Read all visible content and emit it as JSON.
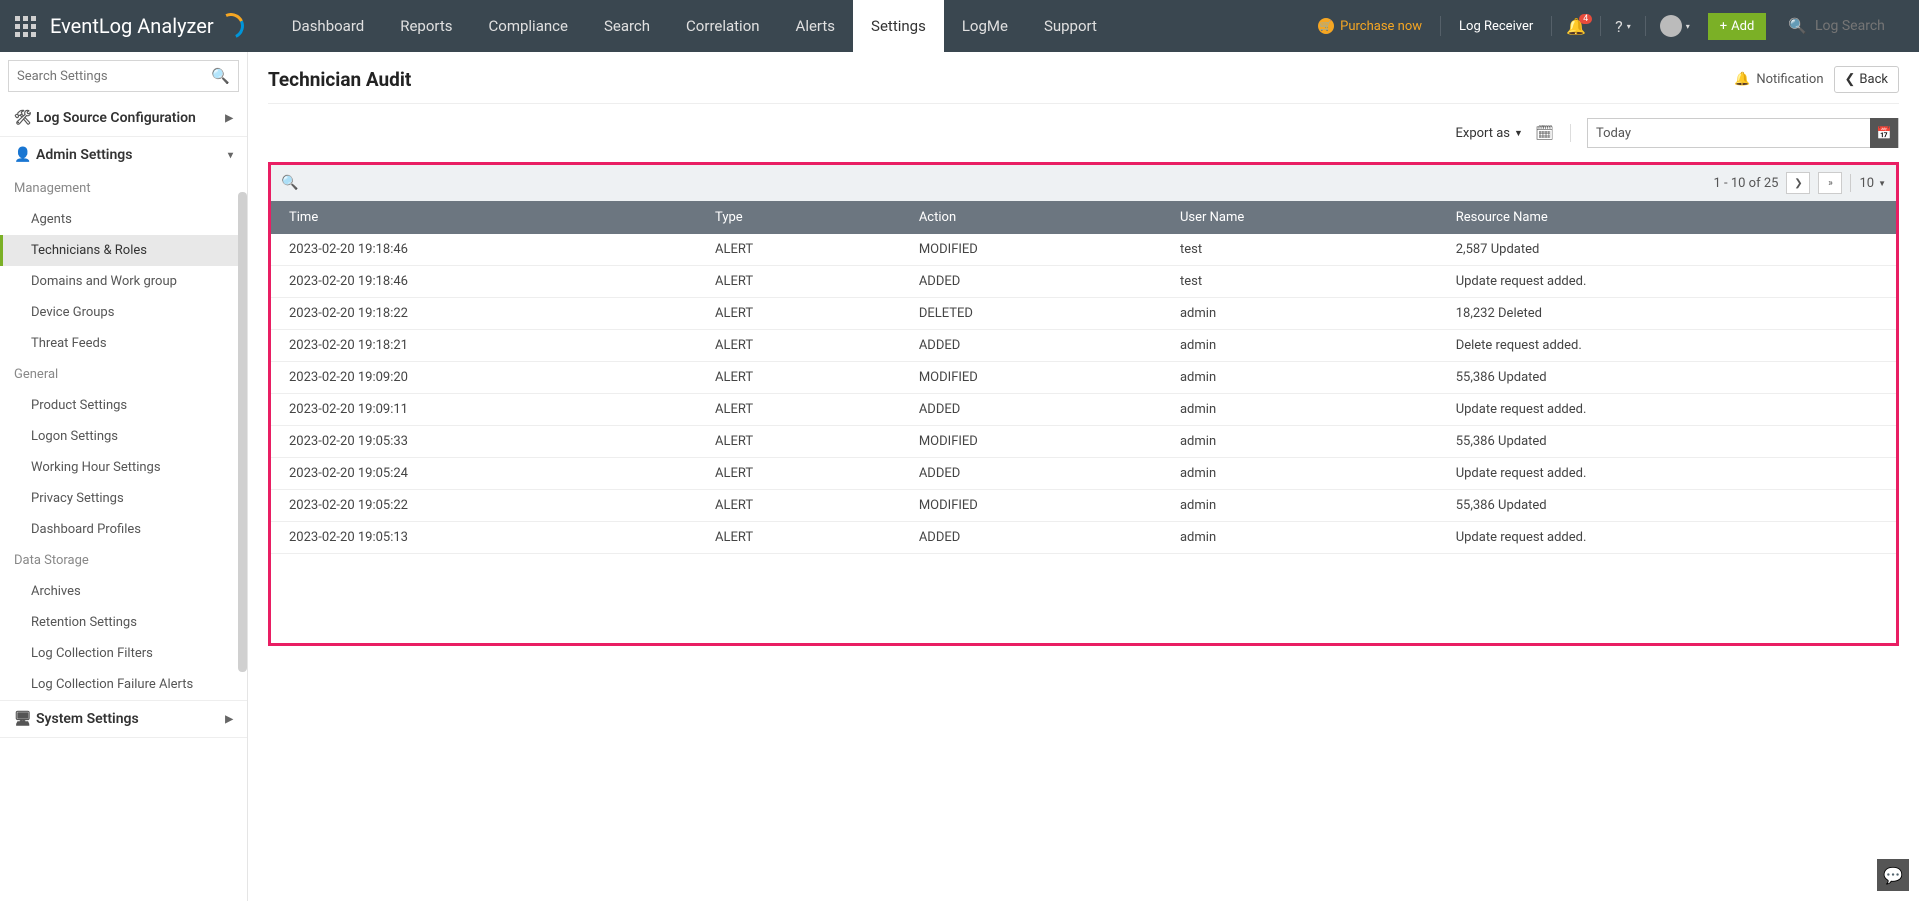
{
  "logo_text": "EventLog Analyzer",
  "nav": [
    "Dashboard",
    "Reports",
    "Compliance",
    "Search",
    "Correlation",
    "Alerts",
    "Settings",
    "LogMe",
    "Support"
  ],
  "nav_active_index": 6,
  "topbar": {
    "purchase": "Purchase now",
    "log_receiver": "Log Receiver",
    "badge": "4",
    "help": "?",
    "add": "Add",
    "log_search_placeholder": "Log Search"
  },
  "sidebar": {
    "search_placeholder": "Search Settings",
    "sections": [
      {
        "label": "Log Source Configuration",
        "icon": "🛠",
        "chev": "▶"
      },
      {
        "label": "Admin Settings",
        "icon": "👤",
        "chev": "▾"
      }
    ],
    "groups": [
      {
        "label": "Management",
        "items": [
          "Agents",
          "Technicians & Roles",
          "Domains and Work group",
          "Device Groups",
          "Threat Feeds"
        ],
        "active_index": 1
      },
      {
        "label": "General",
        "items": [
          "Product Settings",
          "Logon Settings",
          "Working Hour Settings",
          "Privacy Settings",
          "Dashboard Profiles"
        ],
        "active_index": -1
      },
      {
        "label": "Data Storage",
        "items": [
          "Archives",
          "Retention Settings",
          "Log Collection Filters",
          "Log Collection Failure Alerts"
        ],
        "active_index": -1
      }
    ],
    "bottom_section": {
      "label": "System Settings",
      "icon": "🖥",
      "chev": "▶"
    }
  },
  "page": {
    "title": "Technician Audit",
    "notification": "Notification",
    "back": "Back",
    "export": "Export as",
    "date_value": "Today"
  },
  "table": {
    "pager_text": "1 - 10 of 25",
    "page_size": "10",
    "columns": [
      "Time",
      "Type",
      "Action",
      "User Name",
      "Resource Name"
    ],
    "rows": [
      [
        "2023-02-20 19:18:46",
        "ALERT",
        "MODIFIED",
        "test",
        "2,587 Updated"
      ],
      [
        "2023-02-20 19:18:46",
        "ALERT",
        "ADDED",
        "test",
        "Update request added."
      ],
      [
        "2023-02-20 19:18:22",
        "ALERT",
        "DELETED",
        "admin",
        "18,232 Deleted"
      ],
      [
        "2023-02-20 19:18:21",
        "ALERT",
        "ADDED",
        "admin",
        "Delete request added."
      ],
      [
        "2023-02-20 19:09:20",
        "ALERT",
        "MODIFIED",
        "admin",
        "55,386 Updated"
      ],
      [
        "2023-02-20 19:09:11",
        "ALERT",
        "ADDED",
        "admin",
        "Update request added."
      ],
      [
        "2023-02-20 19:05:33",
        "ALERT",
        "MODIFIED",
        "admin",
        "55,386 Updated"
      ],
      [
        "2023-02-20 19:05:24",
        "ALERT",
        "ADDED",
        "admin",
        "Update request added."
      ],
      [
        "2023-02-20 19:05:22",
        "ALERT",
        "MODIFIED",
        "admin",
        "55,386 Updated"
      ],
      [
        "2023-02-20 19:05:13",
        "ALERT",
        "ADDED",
        "admin",
        "Update request added."
      ]
    ]
  }
}
